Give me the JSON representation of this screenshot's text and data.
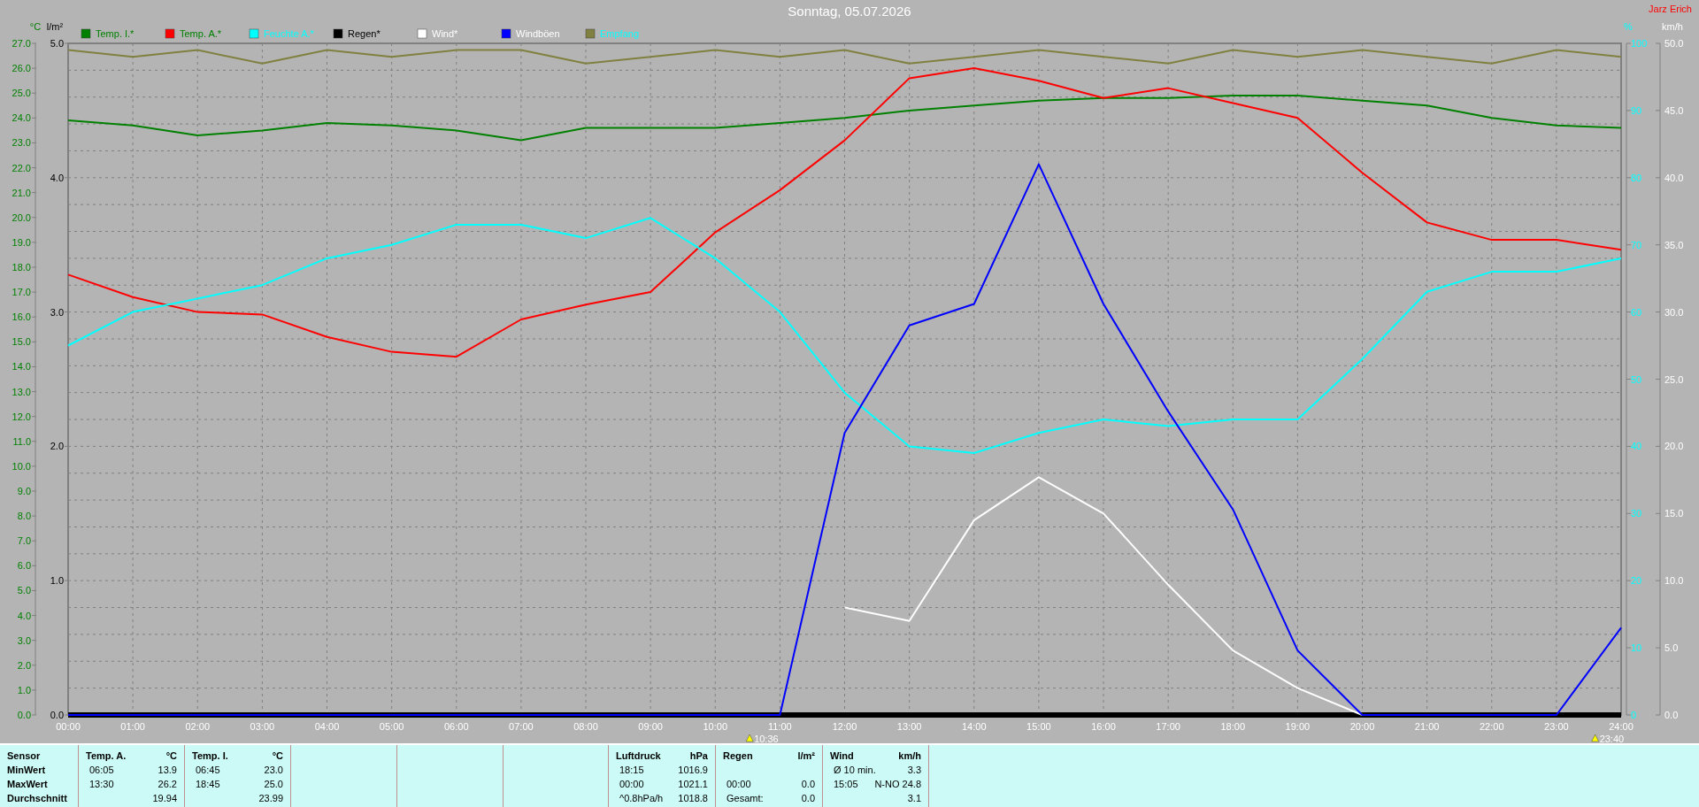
{
  "header": {
    "title": "Sonntag, 05.07.2026",
    "author": "Jarz Erich"
  },
  "chart": {
    "axes": [
      {
        "kind": "temp",
        "unit": "°C"
      },
      {
        "kind": "rain",
        "unit": "l/m²",
        "ticks": [
          "5.0",
          "4.0",
          "3.0",
          "2.0",
          "1.0",
          "0.0"
        ]
      },
      {
        "kind": "percent",
        "unit": "%"
      },
      {
        "kind": "speed",
        "unit": "km/h"
      }
    ],
    "chart_data": {
      "type": "line",
      "categories": [
        "00:00",
        "01:00",
        "02:00",
        "03:00",
        "04:00",
        "05:00",
        "06:00",
        "07:00",
        "08:00",
        "09:00",
        "10:00",
        "11:00",
        "12:00",
        "13:00",
        "14:00",
        "15:00",
        "16:00",
        "17:00",
        "18:00",
        "19:00",
        "20:00",
        "21:00",
        "22:00",
        "23:00",
        "24:00"
      ],
      "grid": true,
      "legend": "top",
      "ylim": [
        0,
        27
      ],
      "y2lim": [
        0,
        100
      ],
      "y2ticks": [
        {
          "value": 0,
          "label": "0"
        },
        {
          "value": 10,
          "label": "10"
        },
        {
          "value": 20,
          "label": "20"
        },
        {
          "value": 30,
          "label": "30"
        },
        {
          "value": 40,
          "label": "40"
        },
        {
          "value": 50,
          "label": "50"
        },
        {
          "value": 60,
          "label": "60"
        },
        {
          "value": 70,
          "label": "70"
        },
        {
          "value": 80,
          "label": "80"
        },
        {
          "value": 90,
          "label": "90"
        },
        {
          "value": 100,
          "label": "100"
        }
      ],
      "y3lim": [
        0,
        50
      ],
      "y3ticks": [
        {
          "value": 0,
          "label": "0.0"
        },
        {
          "value": 5,
          "label": "5.0"
        },
        {
          "value": 10,
          "label": "10.0"
        },
        {
          "value": 15,
          "label": "15.0"
        },
        {
          "value": 20,
          "label": "20.0"
        },
        {
          "value": 25,
          "label": "25.0"
        },
        {
          "value": 30,
          "label": "30.0"
        },
        {
          "value": 35,
          "label": "35.0"
        },
        {
          "value": 40,
          "label": "40.0"
        },
        {
          "value": 45,
          "label": "45.0"
        },
        {
          "value": 50,
          "label": "50.0"
        }
      ],
      "yticks": [
        {
          "value": 0,
          "label": "0.0"
        },
        {
          "value": 1,
          "label": "1.0"
        },
        {
          "value": 2,
          "label": "2.0"
        },
        {
          "value": 3,
          "label": "3.0"
        },
        {
          "value": 4,
          "label": "4.0"
        },
        {
          "value": 5,
          "label": "5.0"
        },
        {
          "value": 6,
          "label": "6.0"
        },
        {
          "value": 7,
          "label": "7.0"
        },
        {
          "value": 8,
          "label": "8.0"
        },
        {
          "value": 9,
          "label": "9.0"
        },
        {
          "value": 10,
          "label": "10.0"
        },
        {
          "value": 11,
          "label": "11.0"
        },
        {
          "value": 12,
          "label": "12.0"
        },
        {
          "value": 13,
          "label": "13.0"
        },
        {
          "value": 14,
          "label": "14.0"
        },
        {
          "value": 15,
          "label": "15.0"
        },
        {
          "value": 16,
          "label": "16.0"
        },
        {
          "value": 17,
          "label": "17.0"
        },
        {
          "value": 18,
          "label": "18.0"
        },
        {
          "value": 19,
          "label": "19.0"
        },
        {
          "value": 20,
          "label": "20.0"
        },
        {
          "value": 21,
          "label": "21.0"
        },
        {
          "value": 22,
          "label": "22.0"
        },
        {
          "value": 23,
          "label": "23.0"
        },
        {
          "value": 24,
          "label": "24.0"
        },
        {
          "value": 25,
          "label": "25.0"
        },
        {
          "value": 26,
          "label": "26.0"
        },
        {
          "value": 27,
          "label": "27.0"
        }
      ],
      "series": [
        {
          "name": "Temp. I.*",
          "color": "#008000",
          "values": [
            23.9,
            23.7,
            23.3,
            23.5,
            23.8,
            23.7,
            23.5,
            23.1,
            23.6,
            23.6,
            23.6,
            23.8,
            24.0,
            24.3,
            24.5,
            24.7,
            24.8,
            24.8,
            24.9,
            24.9,
            24.7,
            24.5,
            24.0,
            23.7,
            23.6
          ]
        },
        {
          "name": "Temp. A.*",
          "color": "#ff0000",
          "values": [
            17.7,
            16.8,
            16.2,
            16.1,
            15.2,
            14.6,
            14.4,
            15.9,
            16.5,
            17.0,
            19.4,
            21.1,
            23.1,
            25.6,
            26.0,
            25.5,
            24.8,
            25.2,
            24.6,
            24.0,
            21.8,
            19.8,
            19.1,
            19.1,
            18.7
          ]
        },
        {
          "name": "Feuchte A.*",
          "color": "#00ffff",
          "axis": "y2",
          "values": [
            55,
            60,
            62,
            64,
            68,
            70,
            73,
            73,
            71,
            74,
            68,
            60,
            48,
            40,
            39,
            42,
            44,
            43,
            44,
            44,
            53,
            63,
            66,
            66,
            68
          ]
        },
        {
          "name": "Regen*",
          "color": "#000000",
          "values": [
            0,
            0,
            0,
            0,
            0,
            0,
            0,
            0,
            0,
            0,
            0,
            0,
            0,
            0,
            0,
            0,
            0,
            0,
            0,
            0,
            0,
            0,
            0,
            0,
            0
          ]
        },
        {
          "name": "Wind*",
          "color": "#ffffff",
          "axis": "y3",
          "values": [
            null,
            null,
            null,
            null,
            null,
            null,
            null,
            null,
            null,
            null,
            null,
            null,
            8.0,
            7.0,
            14.5,
            17.7,
            15.0,
            9.7,
            4.8,
            2.0,
            0.0,
            null,
            null,
            null,
            null
          ]
        },
        {
          "name": "Windböen",
          "color": "#0000ff",
          "axis": "y3",
          "values": [
            0,
            0,
            0,
            0,
            0,
            0,
            0,
            0,
            0,
            0,
            0,
            0,
            21.0,
            29.0,
            30.6,
            41.0,
            30.6,
            22.6,
            15.3,
            4.8,
            0,
            0,
            0,
            0,
            6.5
          ]
        },
        {
          "name": "Empfang",
          "color": "#808040",
          "axis": "y2",
          "values": [
            99,
            98,
            99,
            97,
            99,
            98,
            99,
            99,
            97,
            98,
            99,
            98,
            99,
            97,
            98,
            99,
            98,
            97,
            99,
            98,
            99,
            98,
            97,
            99,
            98
          ]
        }
      ],
      "annotations": [
        "10:36",
        "23:40"
      ]
    }
  },
  "table": {
    "row_labels": [
      "Sensor",
      "MinWert",
      "MaxWert",
      "Durchschnitt"
    ],
    "panels": [
      {
        "kind": "data",
        "title": "Temp. A.",
        "unit": "°C",
        "rows": [
          [
            "06:05",
            "13.9"
          ],
          [
            "13:30",
            "26.2"
          ],
          [
            null,
            "19.94"
          ]
        ]
      },
      {
        "kind": "data",
        "title": "Temp. I.",
        "unit": "°C",
        "rows": [
          [
            "06:45",
            "23.0"
          ],
          [
            "18:45",
            "25.0"
          ],
          [
            null,
            "23.99"
          ]
        ]
      },
      {
        "kind": "blank"
      },
      {
        "kind": "blank"
      },
      {
        "kind": "blank"
      },
      {
        "kind": "data",
        "title": "Luftdruck",
        "unit": "hPa",
        "rows": [
          [
            "18:15",
            "1016.9"
          ],
          [
            "00:00",
            "1021.1"
          ],
          [
            "^0.8hPa/h",
            "1018.8"
          ]
        ]
      },
      {
        "kind": "data",
        "title": "Regen",
        "unit": "l/m²",
        "rows": [
          [
            null,
            null
          ],
          [
            "00:00",
            "0.0"
          ],
          [
            "Gesamt:",
            "0.0"
          ]
        ]
      },
      {
        "kind": "data",
        "title": "Wind",
        "unit": "km/h",
        "rows": [
          [
            "Ø 10 min.",
            "3.3"
          ],
          [
            "15:05",
            "N-NO 24.8"
          ],
          [
            null,
            "3.1"
          ]
        ]
      }
    ]
  }
}
